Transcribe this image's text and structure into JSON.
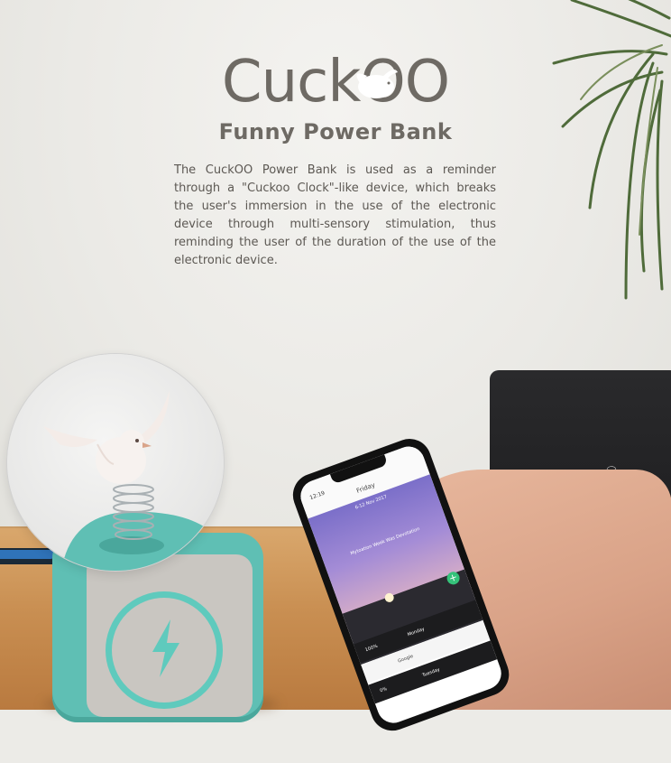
{
  "title": {
    "brand": "CuckOO",
    "subtitle": "Funny Power Bank"
  },
  "description": "The CuckOO Power Bank is used as a reminder through a \"Cuckoo Clock\"-like device, which breaks the user's immersion in the use of the electronic device through multi-sensory stimulation, thus reminding the user of the duration of the use of the electronic device.",
  "colors": {
    "bank_teal": "#5fbfb4",
    "text_gray": "#6e6a64",
    "table_wood": "#c98f52"
  },
  "icons": [
    "bird-logo-icon",
    "lightning-bolt-icon",
    "skull-crossbones-icon",
    "plus-icon"
  ],
  "phone_screen": {
    "time": "12:19",
    "day": "Friday",
    "date": "6-12 Nov 2017",
    "caption": "Mytoation Week Was Devotation",
    "rows": [
      {
        "left": "100%",
        "right": "Monday"
      },
      {
        "left": "",
        "right": "Google"
      },
      {
        "left": "0%",
        "right": "Tuesday"
      }
    ]
  }
}
